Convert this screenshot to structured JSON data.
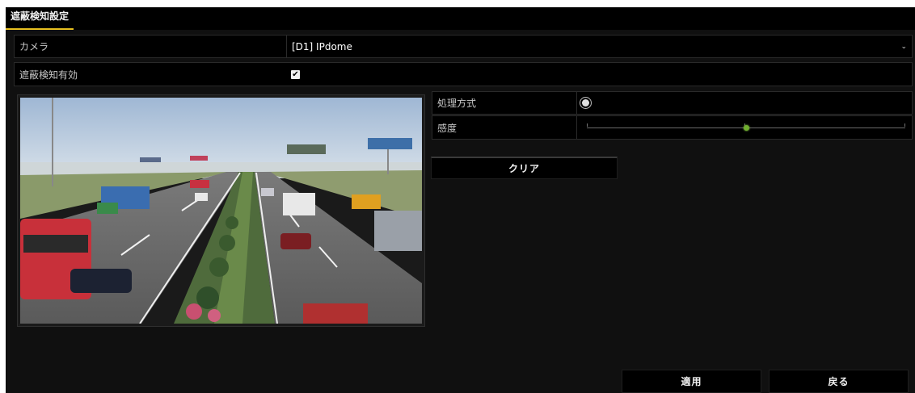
{
  "window": {
    "title": "遮蔽検知設定"
  },
  "camera": {
    "label": "カメラ",
    "value": "[D1] IPdome",
    "arrow_icon": "chevron-down-icon"
  },
  "enable": {
    "label": "遮蔽検知有効",
    "checked": true,
    "check_glyph": "✔"
  },
  "settings": {
    "handling": {
      "label": "処理方式",
      "icon": "gear-icon"
    },
    "sensitivity": {
      "label": "感度",
      "level_fraction": 0.5
    }
  },
  "buttons": {
    "clear": "クリア",
    "apply": "適用",
    "back": "戻る"
  },
  "colors": {
    "accent": "#e8c020",
    "slider": "#6fae2e",
    "background": "#101010"
  }
}
